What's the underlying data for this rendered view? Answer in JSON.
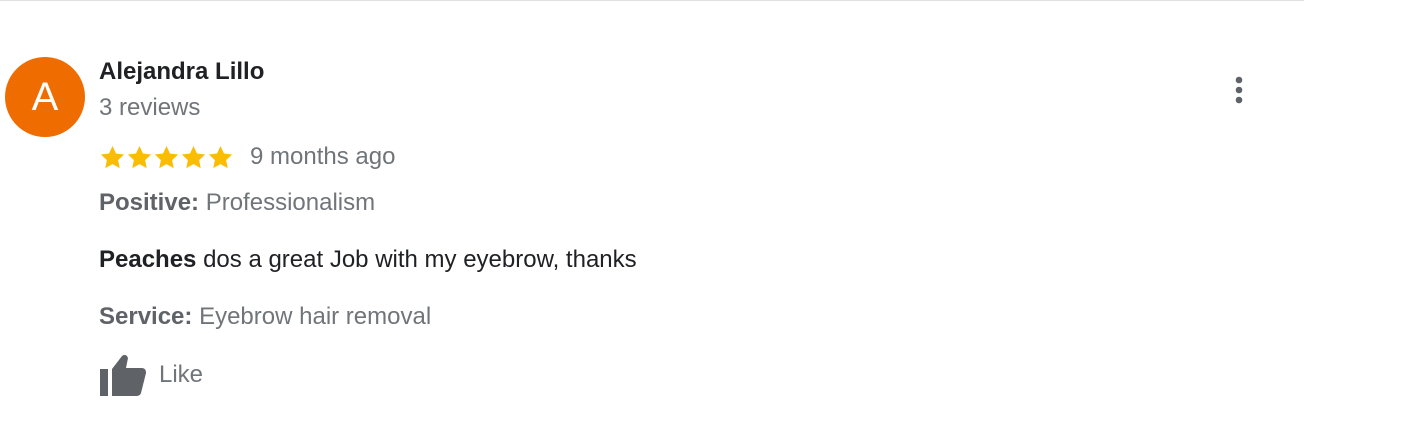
{
  "review": {
    "author": {
      "initial": "A",
      "name": "Alejandra Lillo",
      "reviews": "3 reviews",
      "avatar_color": "#ef6c00"
    },
    "rating": 5,
    "time": "9 months ago",
    "positive": {
      "label": "Positive:",
      "value": "Professionalism"
    },
    "text": {
      "mention": "Peaches",
      "body": " dos a great Job with my eyebrow, thanks"
    },
    "service": {
      "label": "Service:",
      "value": "Eyebrow hair removal"
    },
    "like_label": "Like"
  },
  "icons": {
    "star": "star-icon",
    "more": "more-vertical-icon",
    "like": "thumbs-up-icon"
  },
  "colors": {
    "star": "#fbbc04",
    "avatar": "#ef6c00",
    "icon_gray": "#5f6368"
  }
}
